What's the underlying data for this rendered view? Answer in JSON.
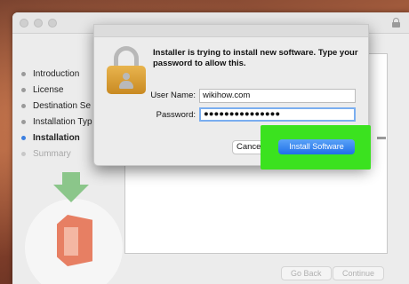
{
  "installer": {
    "steps": [
      {
        "label": "Introduction",
        "state": "done"
      },
      {
        "label": "License",
        "state": "done"
      },
      {
        "label": "Destination Se",
        "state": "done"
      },
      {
        "label": "Installation Typ",
        "state": "done"
      },
      {
        "label": "Installation",
        "state": "active"
      },
      {
        "label": "Summary",
        "state": "pending"
      }
    ],
    "go_back_label": "Go Back",
    "continue_label": "Continue"
  },
  "dialog": {
    "message": "Installer is trying to install new software. Type your password to allow this.",
    "username_label": "User Name:",
    "username_value": "wikihow.com",
    "password_label": "Password:",
    "password_value": "●●●●●●●●●●●●●●●",
    "cancel_label": "Cancel",
    "install_label": "Install Software"
  },
  "colors": {
    "highlight": "#3be21f",
    "primary_button": "#1f6fe8",
    "active_step": "#3b7fe0"
  },
  "icons": [
    "padlock-icon",
    "download-arrow-icon",
    "office-logo-icon",
    "window-lock-icon"
  ]
}
